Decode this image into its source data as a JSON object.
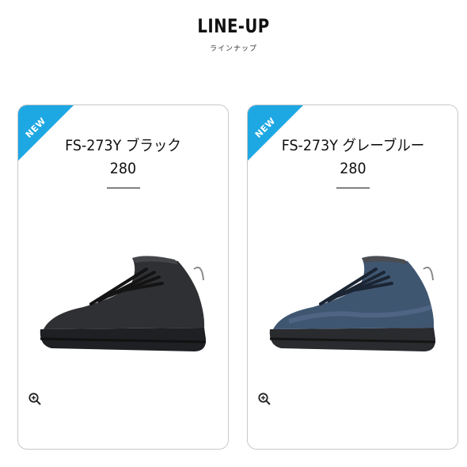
{
  "header": {
    "title": "LINE-UP",
    "subtitle": "ラインナップ"
  },
  "products": [
    {
      "badge": "NEW",
      "name": "FS-273Y ブラック 280",
      "color": "#2f3033",
      "icons": {
        "zoom": "zoom-in-icon"
      }
    },
    {
      "badge": "NEW",
      "name": "FS-273Y グレーブルー 280",
      "color": "#3f5671",
      "icons": {
        "zoom": "zoom-in-icon"
      }
    }
  ],
  "colors": {
    "badge": "#1ea8e3",
    "border": "#c9c9c9"
  }
}
